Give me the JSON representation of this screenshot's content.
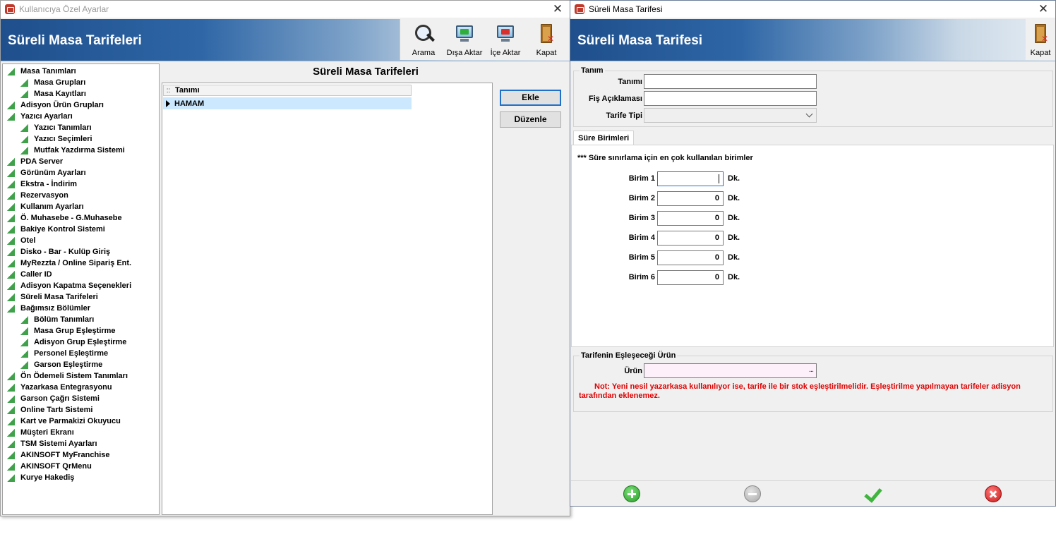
{
  "window1": {
    "title": "Kullanıcıya Özel Ayarlar",
    "banner_title": "Süreli Masa Tarifeleri",
    "toolbar": {
      "search_label": "Arama",
      "export_label": "Dışa Aktar",
      "import_label": "İçe Aktar",
      "close_label": "Kapat"
    },
    "tree": [
      {
        "label": "Masa Tanımları",
        "level": 0
      },
      {
        "label": "Masa Grupları",
        "level": 1
      },
      {
        "label": "Masa Kayıtları",
        "level": 1
      },
      {
        "label": "Adisyon Ürün Grupları",
        "level": 0
      },
      {
        "label": "Yazıcı Ayarları",
        "level": 0
      },
      {
        "label": "Yazıcı Tanımları",
        "level": 1
      },
      {
        "label": "Yazıcı Seçimleri",
        "level": 1
      },
      {
        "label": "Mutfak Yazdırma Sistemi",
        "level": 1
      },
      {
        "label": "PDA Server",
        "level": 0
      },
      {
        "label": "Görünüm Ayarları",
        "level": 0
      },
      {
        "label": "Ekstra - İndirim",
        "level": 0
      },
      {
        "label": "Rezervasyon",
        "level": 0
      },
      {
        "label": "Kullanım Ayarları",
        "level": 0
      },
      {
        "label": "Ö. Muhasebe - G.Muhasebe",
        "level": 0
      },
      {
        "label": "Bakiye Kontrol Sistemi",
        "level": 0
      },
      {
        "label": "Otel",
        "level": 0
      },
      {
        "label": "Disko - Bar - Kulüp Giriş",
        "level": 0
      },
      {
        "label": "MyRezzta / Online Sipariş Ent.",
        "level": 0
      },
      {
        "label": "Caller ID",
        "level": 0
      },
      {
        "label": "Adisyon Kapatma Seçenekleri",
        "level": 0
      },
      {
        "label": "Süreli Masa Tarifeleri",
        "level": 0
      },
      {
        "label": "Bağımsız Bölümler",
        "level": 0
      },
      {
        "label": "Bölüm Tanımları",
        "level": 1
      },
      {
        "label": "Masa Grup Eşleştirme",
        "level": 1
      },
      {
        "label": "Adisyon Grup Eşleştirme",
        "level": 1
      },
      {
        "label": "Personel Eşleştirme",
        "level": 1
      },
      {
        "label": "Garson Eşleştirme",
        "level": 1
      },
      {
        "label": "Ön Ödemeli Sistem Tanımları",
        "level": 0
      },
      {
        "label": "Yazarkasa Entegrasyonu",
        "level": 0
      },
      {
        "label": "Garson Çağrı Sistemi",
        "level": 0
      },
      {
        "label": "Online Tartı Sistemi",
        "level": 0
      },
      {
        "label": "Kart ve Parmakizi Okuyucu",
        "level": 0
      },
      {
        "label": "Müşteri Ekranı",
        "level": 0
      },
      {
        "label": "TSM Sistemi Ayarları",
        "level": 0
      },
      {
        "label": "AKINSOFT MyFranchise",
        "level": 0
      },
      {
        "label": "AKINSOFT QrMenu",
        "level": 0
      },
      {
        "label": "Kurye Hakediş",
        "level": 0
      }
    ],
    "list_title": "Süreli Masa Tarifeleri",
    "grid": {
      "indicator": "::",
      "column": "Tanımı",
      "rows": [
        "HAMAM"
      ]
    },
    "buttons": {
      "add": "Ekle",
      "edit": "Düzenle"
    }
  },
  "window2": {
    "title": "Süreli Masa Tarifesi",
    "banner_title": "Süreli Masa Tarifesi",
    "close_label": "Kapat",
    "group_tanim": "Tanım",
    "fields": {
      "tanimi_label": "Tanımı",
      "tanimi_value": "",
      "fis_label": "Fiş Açıklaması",
      "fis_value": "",
      "tarife_label": "Tarife Tipi",
      "tarife_value": ""
    },
    "tab": "Süre Birimleri",
    "units_note": "*** Süre sınırlama için en çok kullanılan birimler",
    "units": [
      {
        "label": "Birim 1",
        "value": "",
        "suffix": "Dk."
      },
      {
        "label": "Birim 2",
        "value": "0",
        "suffix": "Dk."
      },
      {
        "label": "Birim 3",
        "value": "0",
        "suffix": "Dk."
      },
      {
        "label": "Birim 4",
        "value": "0",
        "suffix": "Dk."
      },
      {
        "label": "Birim 5",
        "value": "0",
        "suffix": "Dk."
      },
      {
        "label": "Birim 6",
        "value": "0",
        "suffix": "Dk."
      }
    ],
    "group_product": "Tarifenin Eşleşeceği Ürün",
    "urun_label": "Ürün",
    "urun_value": "",
    "urun_button": "...",
    "warning": "Not: Yeni nesil yazarkasa kullanılıyor ise, tarife ile bir stok eşleştirilmelidir. Eşleştirilme yapılmayan tarifeler adisyon tarafından eklenemez."
  }
}
